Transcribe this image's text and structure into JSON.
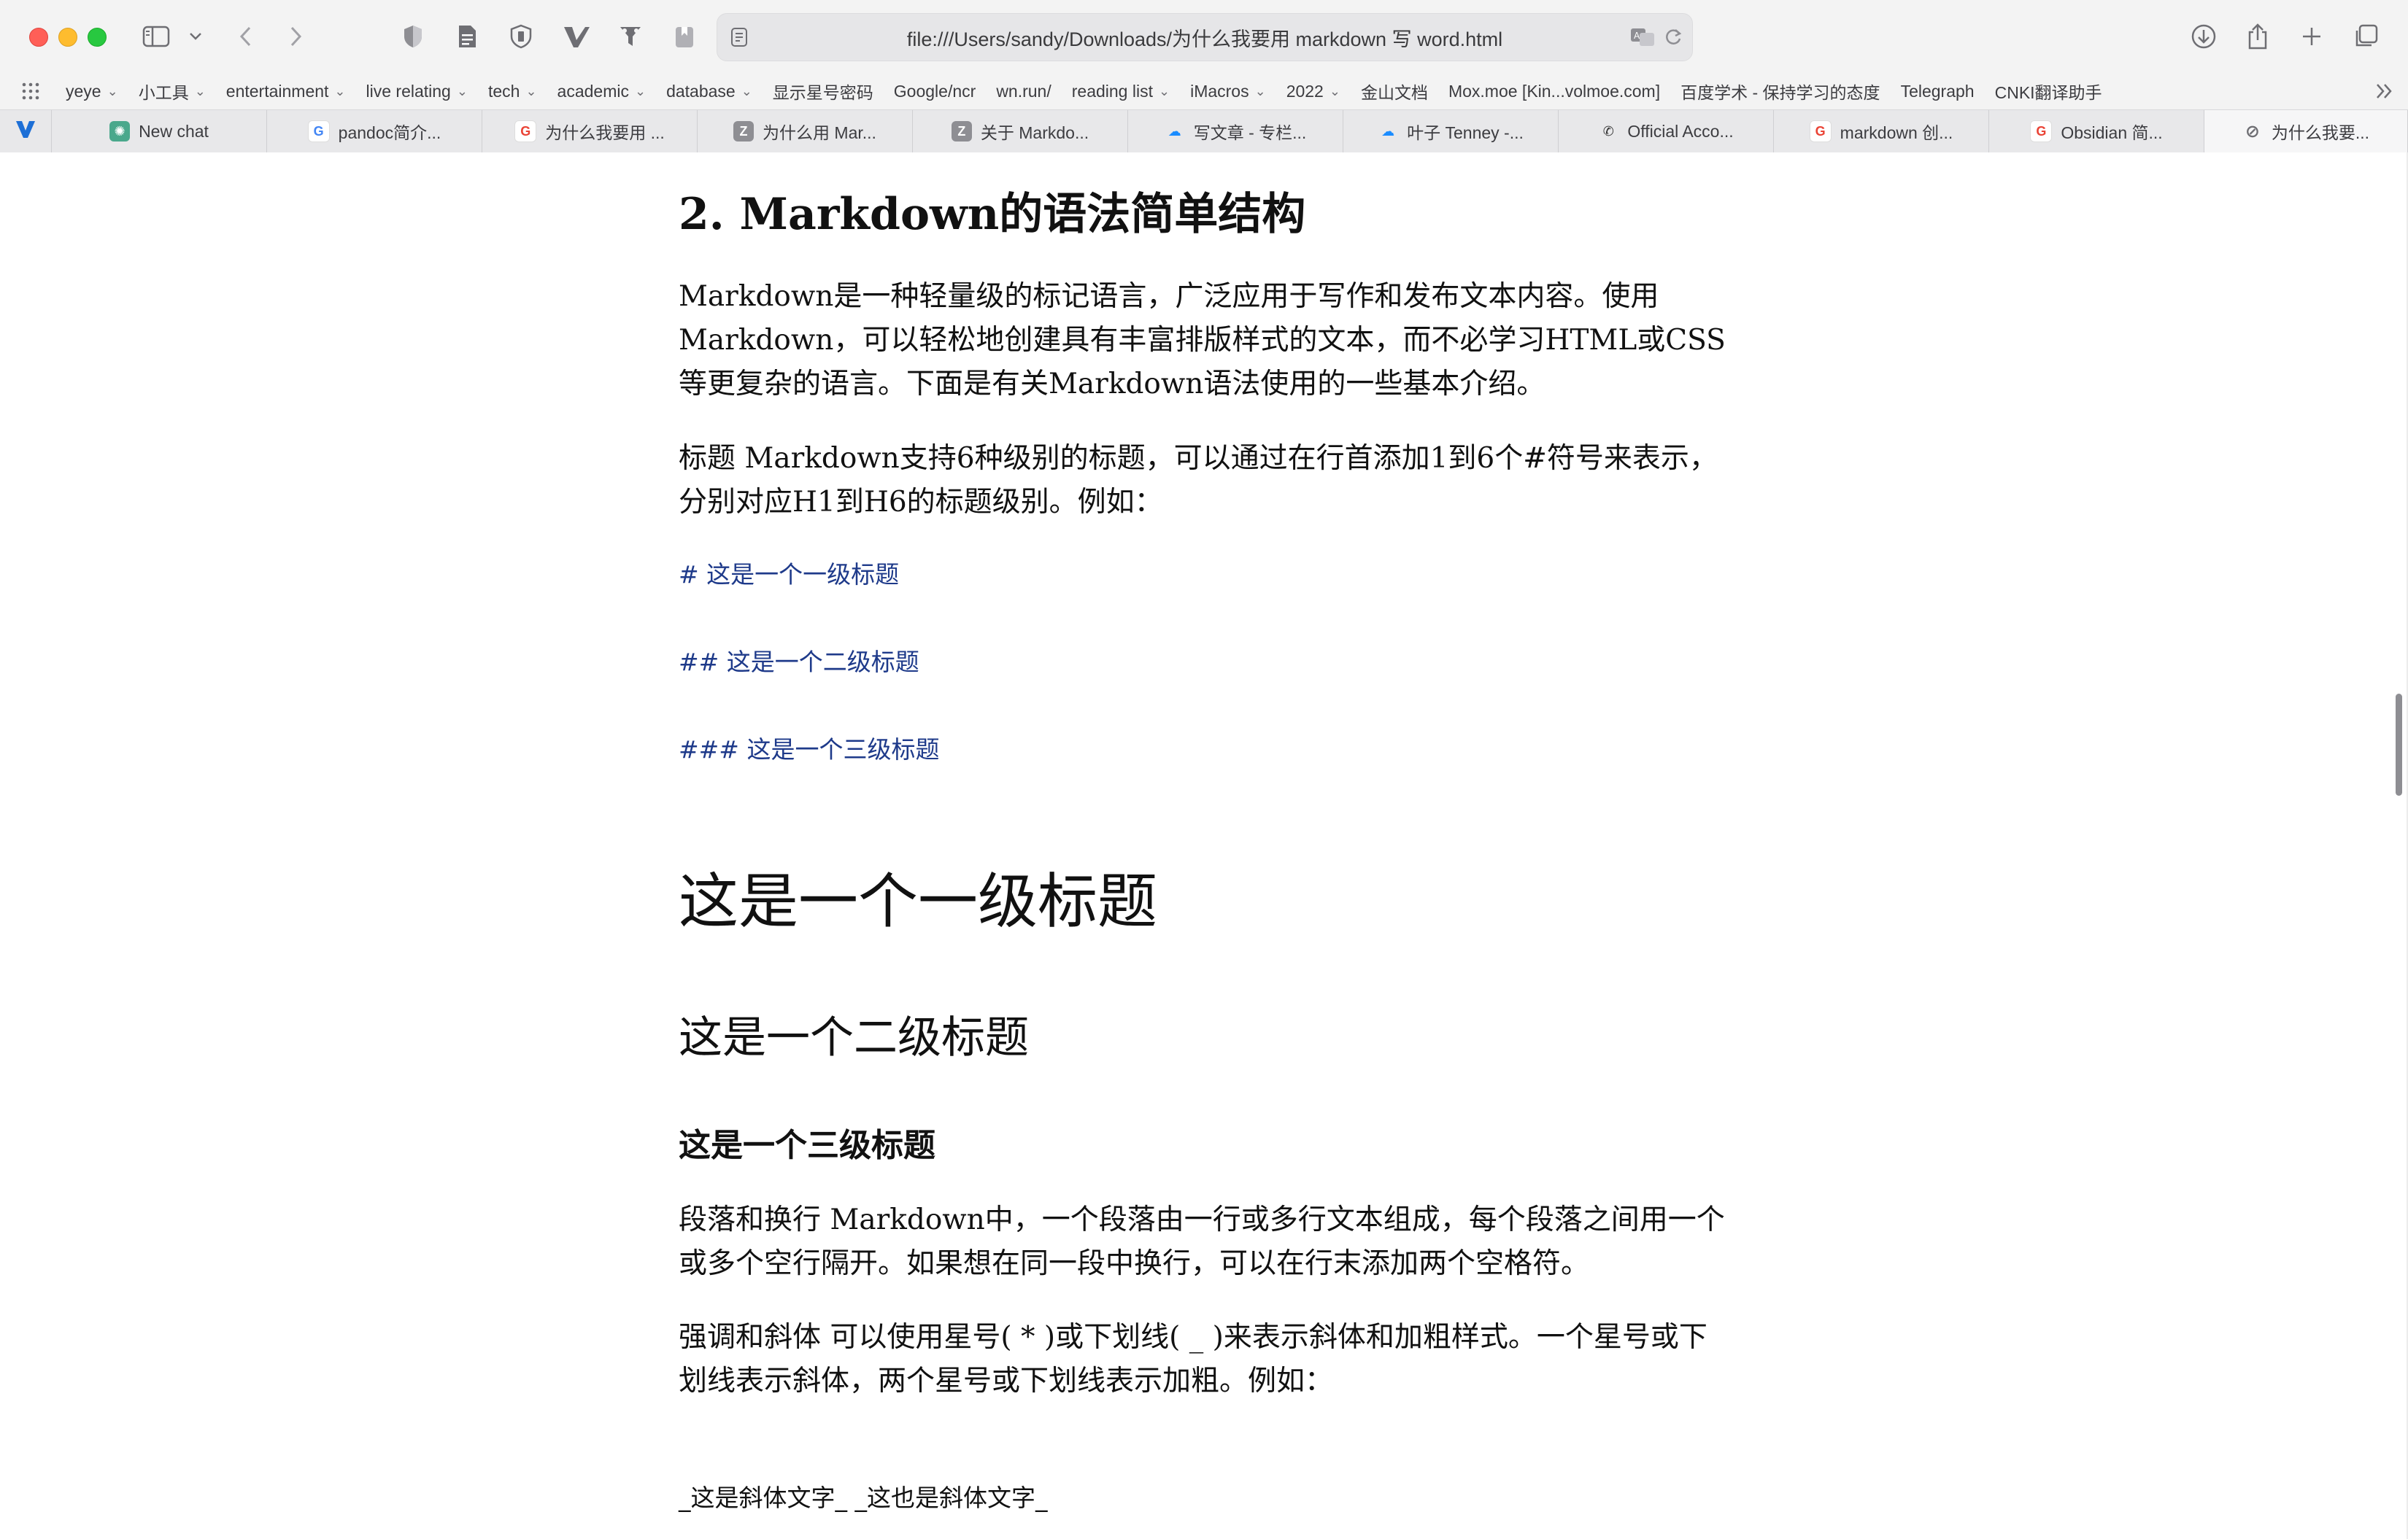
{
  "browser": {
    "url": "file:///Users/sandy/Downloads/为什么我要用 markdown 写 word.html"
  },
  "bookmarks": [
    {
      "label": "yeye",
      "menu": true
    },
    {
      "label": "小工具",
      "menu": true
    },
    {
      "label": "entertainment",
      "menu": true
    },
    {
      "label": "live relating",
      "menu": true
    },
    {
      "label": "tech",
      "menu": true
    },
    {
      "label": "academic",
      "menu": true
    },
    {
      "label": "database",
      "menu": true
    },
    {
      "label": "显示星号密码",
      "menu": false
    },
    {
      "label": "Google/ncr",
      "menu": false
    },
    {
      "label": "wn.run/",
      "menu": false
    },
    {
      "label": "reading list",
      "menu": true
    },
    {
      "label": "iMacros",
      "menu": true
    },
    {
      "label": "2022",
      "menu": true
    },
    {
      "label": "金山文档",
      "menu": false
    },
    {
      "label": "Mox.moe [Kin...volmoe.com]",
      "menu": false
    },
    {
      "label": "百度学术 - 保持学习的态度",
      "menu": false
    },
    {
      "label": "Telegraph",
      "menu": false
    },
    {
      "label": "CNKI翻译助手",
      "menu": false
    }
  ],
  "tabs": [
    {
      "label": "New chat",
      "icon": "chatgpt-icon"
    },
    {
      "label": "pandoc简介...",
      "icon": "google-icon"
    },
    {
      "label": "为什么我要用 ...",
      "icon": "google-icon"
    },
    {
      "label": "为什么用 Mar...",
      "icon": "zhihu-icon"
    },
    {
      "label": "关于 Markdo...",
      "icon": "zhihu-icon"
    },
    {
      "label": "写文章 - 专栏...",
      "icon": "cloud-icon"
    },
    {
      "label": "叶子 Tenney -...",
      "icon": "cloud-icon"
    },
    {
      "label": "Official Acco...",
      "icon": "wechat-icon"
    },
    {
      "label": "markdown 创...",
      "icon": "google-icon"
    },
    {
      "label": "Obsidian 简...",
      "icon": "google-icon"
    },
    {
      "label": "为什么我要...",
      "icon": "compass-icon"
    }
  ],
  "article": {
    "section_heading": "2. Markdown的语法简单结构",
    "intro": "Markdown是一种轻量级的标记语言，广泛应用于写作和发布文本内容。使用Markdown，可以轻松地创建具有丰富排版样式的文本，而不必学习HTML或CSS等更复杂的语言。下面是有关Markdown语法使用的一些基本介绍。",
    "headings_desc": "标题 Markdown支持6种级别的标题，可以通过在行首添加1到6个#符号来表示，分别对应H1到H6的标题级别。例如：",
    "code_h1": "#  这是一个一级标题",
    "code_h2": "##  这是一个二级标题",
    "code_h3": "###  这是一个三级标题",
    "demo_h1": "这是一个一级标题",
    "demo_h2": "这是一个二级标题",
    "demo_h3": "这是一个三级标题",
    "paragraph_desc": "段落和换行 Markdown中，一个段落由一行或多行文本组成，每个段落之间用一个或多个空行隔开。如果想在同一段中换行，可以在行末添加两个空格符。",
    "emphasis_desc": "强调和斜体 可以使用星号( * )或下划线( _ )来表示斜体和加粗样式。一个星号或下划线表示斜体，两个星号或下划线表示加粗。例如：",
    "italic_example": "_这是斜体文字_  _这也是斜体文字_"
  }
}
